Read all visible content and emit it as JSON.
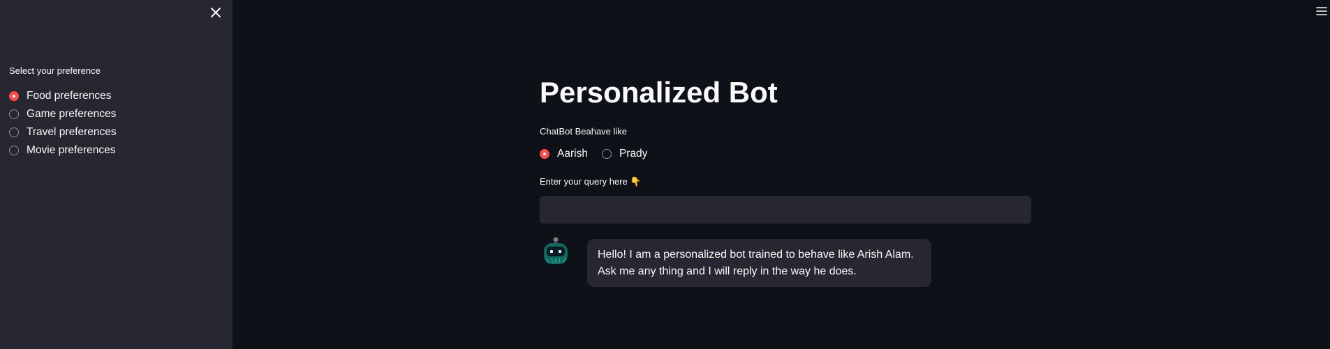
{
  "sidebar": {
    "label": "Select your preference",
    "options": [
      {
        "label": "Food preferences",
        "selected": true
      },
      {
        "label": "Game preferences",
        "selected": false
      },
      {
        "label": "Travel preferences",
        "selected": false
      },
      {
        "label": "Movie preferences",
        "selected": false
      }
    ]
  },
  "main": {
    "title": "Personalized Bot",
    "behave_label": "ChatBot Beahave like",
    "behave_options": [
      {
        "label": "Aarish",
        "selected": true
      },
      {
        "label": "Prady",
        "selected": false
      }
    ],
    "query_label": "Enter your query here 👇",
    "query_value": "",
    "bot_message": {
      "line1": "Hello! I am a personalized bot trained to behave like Arish Alam.",
      "line2": "Ask me any thing and I will reply in the way he does."
    }
  },
  "icons": {
    "close": "close-icon",
    "menu": "hamburger-menu-icon",
    "avatar": "bot-avatar-icon"
  },
  "colors": {
    "background": "#0e1117",
    "sidebar": "#262730",
    "accent": "#ff4b4b",
    "text": "#fafafa"
  }
}
